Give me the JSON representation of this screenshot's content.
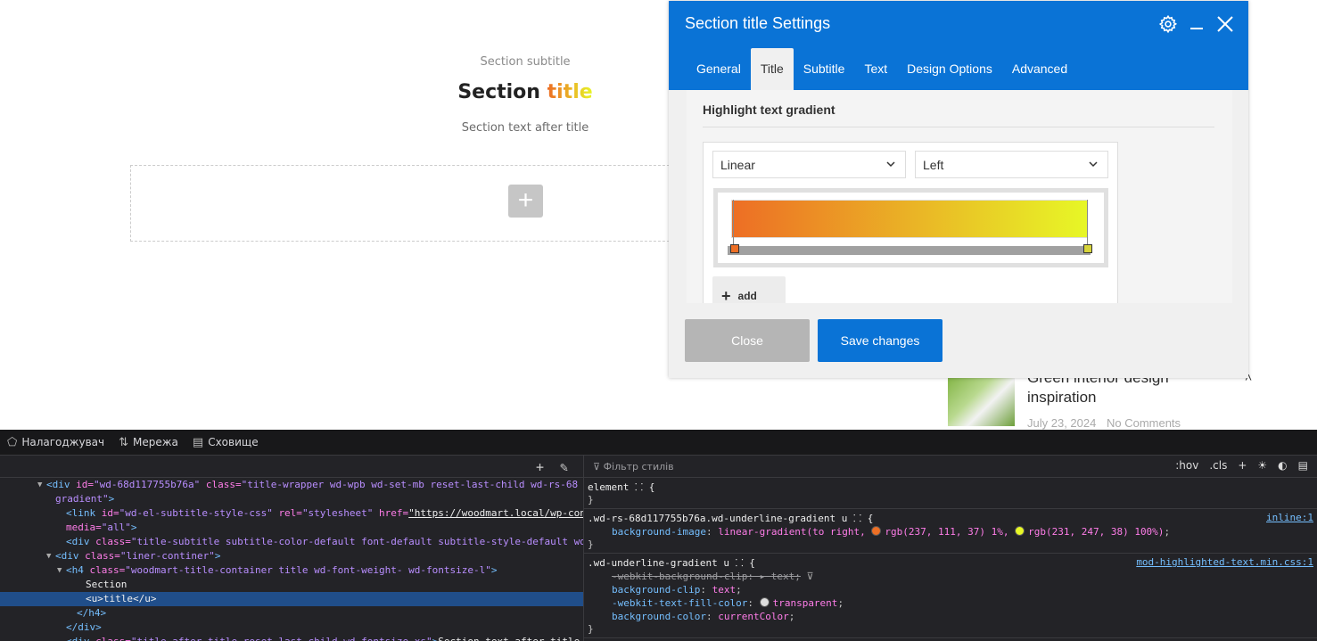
{
  "preview": {
    "subtitle": "Section subtitle",
    "title_plain": "Section",
    "title_highlight": "title",
    "text_after": "Section text after title",
    "add_icon": "plus-icon"
  },
  "blog": {
    "title": "Green interior design inspiration",
    "date": "July 23, 2024",
    "comments": "No Comments"
  },
  "modal": {
    "title": "Section title Settings",
    "tabs": [
      "General",
      "Title",
      "Subtitle",
      "Text",
      "Design Options",
      "Advanced"
    ],
    "active_tab": "Title",
    "section_heading": "Highlight text gradient",
    "gradient_type": "Linear",
    "gradient_direction": "Left",
    "gradient_stops": [
      {
        "color": "#ed6f25",
        "position": "1%"
      },
      {
        "color": "#e7f726",
        "position": "100%"
      }
    ],
    "add_label": "add",
    "close_label": "Close",
    "save_label": "Save changes",
    "accent": "#0a73d6"
  },
  "devtools": {
    "tabs": [
      "Налагоджувач",
      "Мережа",
      "Сховище"
    ],
    "filter_placeholder": "Фільтр стилів",
    "toolbar_right": [
      ":hov",
      ".cls"
    ],
    "html_lines": [
      {
        "indent": 52,
        "arrow": "▼",
        "html": "<span class='tag'>&lt;div</span> <span class='attr'>id=</span><span class='val'>\"wd-68d117755b76a\"</span> <span class='attr'>class=</span><span class='val'>\"title-wrapper wd-wpb wd-set-mb reset-last-child wd-rs-68</span>"
      },
      {
        "indent": 62,
        "arrow": "",
        "html": "<span class='val'>gradient\"</span><span class='tag'>&gt;</span>"
      },
      {
        "indent": 74,
        "arrow": "",
        "html": "<span class='tag'>&lt;link</span> <span class='attr'>id=</span><span class='val'>\"wd-el-subtitle-style-css\"</span> <span class='attr'>rel=</span><span class='val'>\"stylesheet\"</span> <span class='attr'>href=</span><span class='val' style='text-decoration:underline;color:#eee'>\"https://woodmart.local/wp-cont</span>"
      },
      {
        "indent": 74,
        "arrow": "",
        "html": "<span class='attr'>media=</span><span class='val'>\"all\"</span><span class='tag'>&gt;</span>"
      },
      {
        "indent": 74,
        "arrow": "",
        "html": "<span class='tag'>&lt;div</span> <span class='attr'>class=</span><span class='val'>\"title-subtitle subtitle-color-default font-default subtitle-style-default wd</span>"
      },
      {
        "indent": 62,
        "arrow": "▼",
        "html": "<span class='tag'>&lt;div</span> <span class='attr'>class=</span><span class='val'>\"liner-continer\"</span><span class='tag'>&gt;</span>"
      },
      {
        "indent": 74,
        "arrow": "▼",
        "html": "<span class='tag'>&lt;h4</span> <span class='attr'>class=</span><span class='val'>\"woodmart-title-container title wd-font-weight- wd-fontsize-l\"</span><span class='tag'>&gt;</span>"
      },
      {
        "indent": 96,
        "arrow": "",
        "html": "<span class='txt'>Section</span>"
      },
      {
        "indent": 96,
        "arrow": "",
        "html": "<span class='txt'>&lt;u&gt;title&lt;/u&gt;</span>",
        "selected": true
      },
      {
        "indent": 86,
        "arrow": "",
        "html": "<span class='tag'>&lt;/h4&gt;</span>"
      },
      {
        "indent": 74,
        "arrow": "",
        "html": "<span class='tag'>&lt;/div&gt;</span>"
      },
      {
        "indent": 74,
        "arrow": "",
        "html": "<span class='tag'>&lt;div</span> <span class='attr'>class=</span><span class='val'>\"title-after_title reset-last-child wd-fontsize-xs\"</span><span class='tag'>&gt;</span><span class='txt'>Section text after title</span>"
      }
    ],
    "rules": [
      {
        "selector": "element ⸬ {",
        "source": "",
        "decls": [],
        "close": "}"
      },
      {
        "selector": ".wd-rs-68d117755b76a.wd-underline-gradient u ⸬ {",
        "source": "inline:1",
        "decls": [
          {
            "html": "<span class='prop'>background-image</span>: <span class='pval'>linear-gradient(to right, <span class='swatch' style='background:#ed6f25'></span>rgb(237, 111, 37) 1%, <span class='swatch' style='background:#e7f726'></span>rgb(231, 247, 38) 100%)</span>;"
          }
        ],
        "close": "}"
      },
      {
        "selector": ".wd-underline-gradient u ⸬ {",
        "source": "mod-highlighted-text.min.css:1",
        "decls": [
          {
            "html": "<span class='strike'>-webkit-background-clip: ▸ text;</span> <span style='color:#aaa'>⊽</span>"
          },
          {
            "html": "<span class='prop'>background-clip</span>: <span class='pval'>text</span>;"
          },
          {
            "html": "<span class='prop'>-webkit-text-fill-color</span>: <span class='swatch' style='background:#ddd'></span><span class='pval'>transparent</span>;"
          },
          {
            "html": "<span class='prop'>background-color</span>: <span class='pval'>currentColor</span>;"
          }
        ],
        "close": "}"
      }
    ]
  }
}
